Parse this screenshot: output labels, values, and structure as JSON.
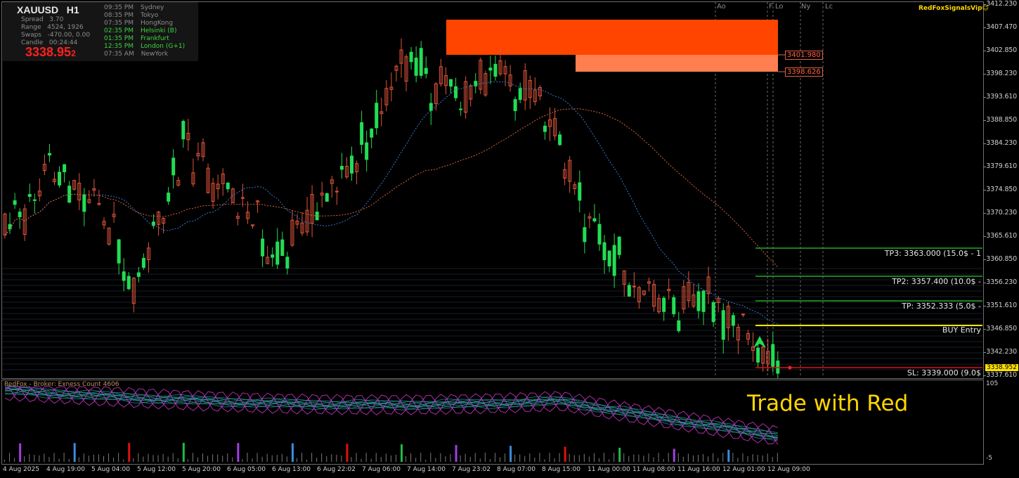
{
  "window": {
    "symbol": "XAUUSD",
    "timeframe": "H1"
  },
  "info_panel": {
    "rows": [
      {
        "label": "Spread",
        "value": "3.70"
      },
      {
        "label": "Range",
        "value": "4524, 1926"
      },
      {
        "label": "Swaps",
        "value": "-470.00, 0.00"
      },
      {
        "label": "Candle",
        "value": "00:24:44"
      }
    ],
    "price_main": "3338.95",
    "price_small": "2",
    "sessions": [
      {
        "time": "09:35 PM",
        "city": "Sydney",
        "active": false
      },
      {
        "time": "08:35 PM",
        "city": "Tokyo",
        "active": false
      },
      {
        "time": "07:35 PM",
        "city": "HongKong",
        "active": false
      },
      {
        "time": "02:35 PM",
        "city": "Helsinki  (B)",
        "active": true,
        "color": "#3fd43f"
      },
      {
        "time": "01:35 PM",
        "city": "Frankfurt",
        "active": true,
        "color": "#3fd43f"
      },
      {
        "time": "12:35 PM",
        "city": "London  (G+1)",
        "active": true,
        "color": "#3fd43f"
      },
      {
        "time": "07:35 AM",
        "city": "NewYork",
        "active": false
      }
    ]
  },
  "session_markers": [
    "Ao",
    "F",
    "Lo",
    "Ny",
    "Lc"
  ],
  "brand": "RedFoxSignalsVip",
  "tagline": "Trade with Red",
  "price_axis": [
    "3412.230",
    "3407.470",
    "3402.850",
    "3398.230",
    "3393.610",
    "3388.850",
    "3384.230",
    "3379.610",
    "3374.850",
    "3370.230",
    "3365.610",
    "3360.850",
    "3356.230",
    "3351.610",
    "3346.850",
    "3342.230",
    "3337.610"
  ],
  "current_price": "3338.952",
  "zones": [
    {
      "label": "3401.980",
      "color": "#ff4500"
    },
    {
      "label": "3398.626",
      "color": "#ff7f50"
    }
  ],
  "levels": [
    {
      "label": "TP3: 3363.000 (15.0$ - 1",
      "color": "#22aa22"
    },
    {
      "label": "TP2: 3357.400 (10.0$ -",
      "color": "#22aa22"
    },
    {
      "label": "TP: 3352.333 (5.0$ -",
      "color": "#22aa22"
    },
    {
      "label": "BUY Entry",
      "color": "#ffe600"
    },
    {
      "label": "SL: 3339.000 (9.0$",
      "color": "#e01010"
    }
  ],
  "indicator": {
    "title": "RedFox - Broker: Exness   Count  4606",
    "axis_top": "105",
    "axis_bottom": "-5"
  },
  "time_axis": [
    "4 Aug 2025",
    "4 Aug 19:00",
    "5 Aug 04:00",
    "5 Aug 12:00",
    "5 Aug 20:00",
    "6 Aug 05:00",
    "6 Aug 13:00",
    "6 Aug 22:02",
    "7 Aug 06:00",
    "7 Aug 14:00",
    "7 Aug 23:02",
    "8 Aug 07:00",
    "8 Aug 15:00",
    "11 Aug 00:00",
    "11 Aug 08:00",
    "11 Aug 16:00",
    "12 Aug 01:00",
    "12 Aug 09:00"
  ],
  "colors": {
    "bull": "#22dd55",
    "bear": "#e0553a",
    "ema_fast": "#3a78d0",
    "ema_slow": "#d8643a",
    "indicator_ribbon": "#2ec4c4",
    "indicator_magenta": "#d23ad2"
  },
  "chart_data": {
    "type": "candlestick",
    "title": "XAUUSD H1",
    "ylim": [
      3337.0,
      3412.3
    ],
    "x": [
      "4 Aug 2025",
      "4 Aug 19:00",
      "5 Aug 04:00",
      "5 Aug 12:00",
      "5 Aug 20:00",
      "6 Aug 05:00",
      "6 Aug 13:00",
      "6 Aug 22:02",
      "7 Aug 06:00",
      "7 Aug 14:00",
      "7 Aug 23:02",
      "8 Aug 07:00",
      "8 Aug 15:00",
      "11 Aug 00:00",
      "11 Aug 08:00",
      "11 Aug 16:00",
      "12 Aug 01:00",
      "12 Aug 09:00"
    ],
    "close": [
      3366.0,
      3377.5,
      3372.0,
      3354.0,
      3384.0,
      3374.0,
      3362.0,
      3371.0,
      3383.0,
      3401.5,
      3393.0,
      3397.0,
      3392.0,
      3370.0,
      3357.0,
      3350.0,
      3352.0,
      3339.0
    ],
    "indicator_ylim": [
      -5,
      105
    ]
  }
}
